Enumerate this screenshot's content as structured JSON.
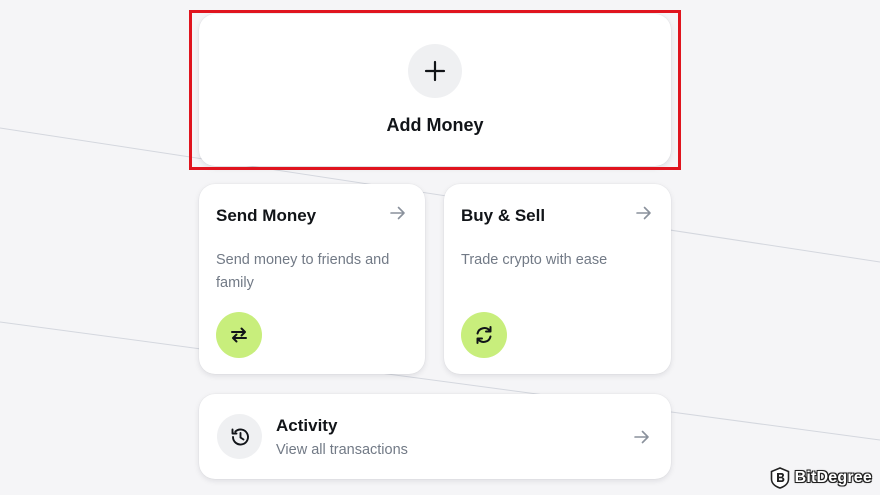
{
  "add_money": {
    "label": "Add Money",
    "icon": "plus-icon"
  },
  "send_money": {
    "title": "Send Money",
    "description": "Send money to friends and family",
    "icon": "swap-arrows-icon",
    "arrow_icon": "arrow-right-icon"
  },
  "buy_sell": {
    "title": "Buy & Sell",
    "description": "Trade crypto with ease",
    "icon": "refresh-icon",
    "arrow_icon": "arrow-right-icon"
  },
  "activity": {
    "title": "Activity",
    "subtitle": "View all transactions",
    "icon": "history-icon",
    "arrow_icon": "arrow-right-icon"
  },
  "watermark": {
    "text": "BitDegree",
    "icon": "bitdegree-logo-icon"
  },
  "colors": {
    "accent_green": "#c8ee7c",
    "highlight_red": "#e0141e",
    "icon_bg": "#eff0f2",
    "muted_text": "#727a86"
  }
}
